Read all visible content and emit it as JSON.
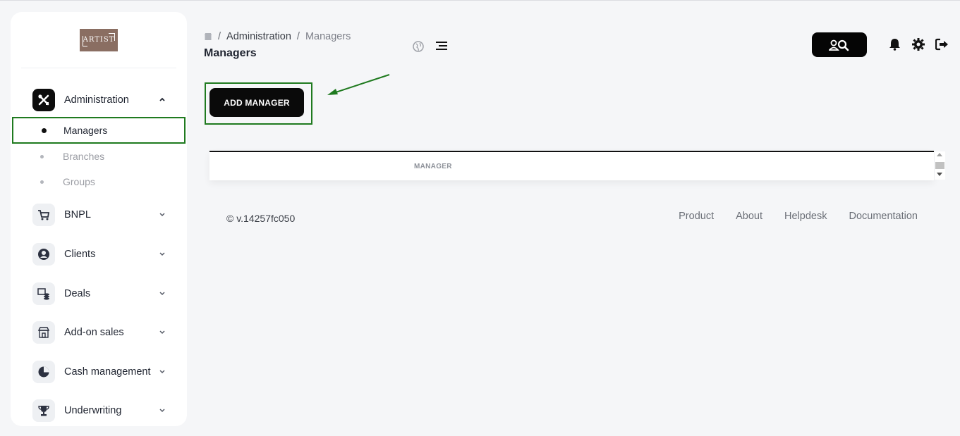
{
  "brand": {
    "logo_text": "ARTIST"
  },
  "sidebar": {
    "items": [
      {
        "label": "Administration",
        "icon": "tools-icon",
        "expanded": true,
        "children": [
          {
            "label": "Managers",
            "active": true
          },
          {
            "label": "Branches"
          },
          {
            "label": "Groups"
          }
        ]
      },
      {
        "label": "BNPL",
        "icon": "cart-icon"
      },
      {
        "label": "Clients",
        "icon": "user-circle-icon"
      },
      {
        "label": "Deals",
        "icon": "deals-icon"
      },
      {
        "label": "Add-on sales",
        "icon": "store-icon"
      },
      {
        "label": "Cash management",
        "icon": "pie-chart-icon"
      },
      {
        "label": "Underwriting",
        "icon": "trophy-icon"
      }
    ]
  },
  "header": {
    "breadcrumb": [
      "Administration",
      "Managers"
    ],
    "title": "Managers"
  },
  "main": {
    "add_button": "ADD MANAGER",
    "table": {
      "columns": [
        "MANAGER"
      ]
    }
  },
  "footer": {
    "version": "© v.14257fc050",
    "links": [
      "Product",
      "About",
      "Helpdesk",
      "Documentation"
    ]
  },
  "colors": {
    "highlight": "#1f7a1f",
    "primary": "#0a0a0a"
  }
}
